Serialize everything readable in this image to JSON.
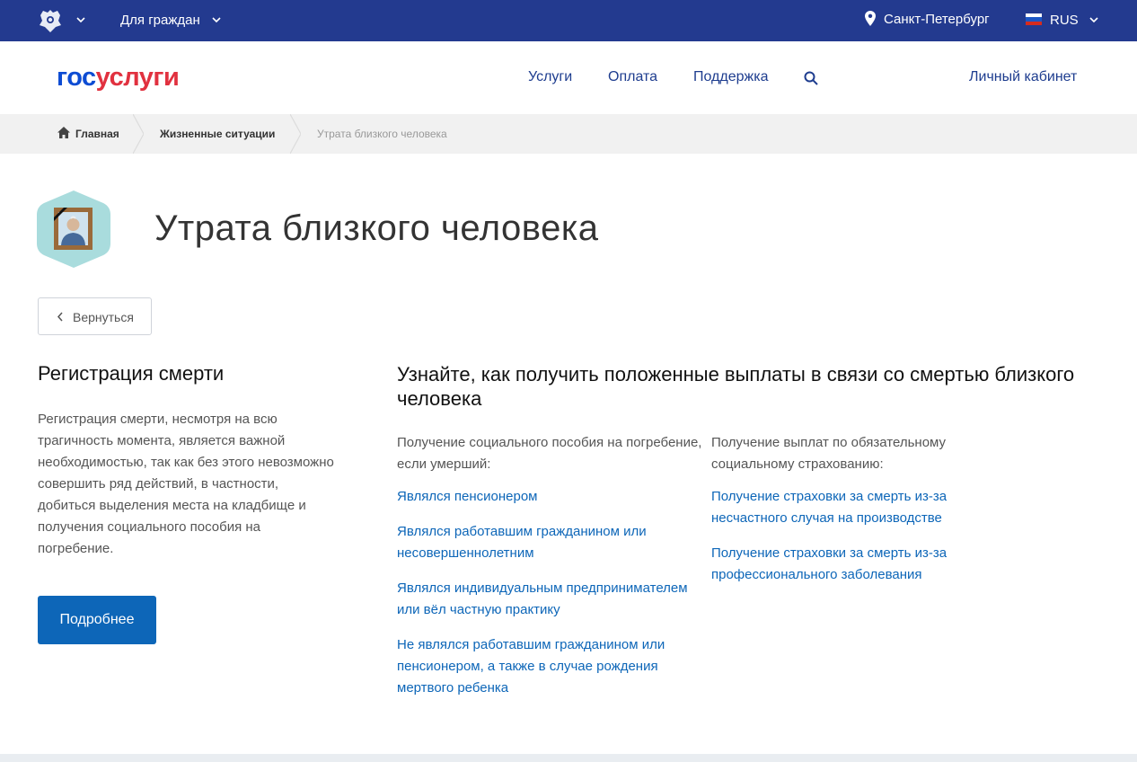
{
  "topbar": {
    "for_citizens": "Для граждан",
    "city": "Санкт-Петербург",
    "lang": "RUS"
  },
  "header": {
    "logo_gos": "гос",
    "logo_uslugi": "услуги",
    "nav": [
      "Услуги",
      "Оплата",
      "Поддержка"
    ],
    "cabinet": "Личный кабинет"
  },
  "breadcrumb": {
    "home": "Главная",
    "section": "Жизненные ситуации",
    "current": "Утрата близкого человека"
  },
  "page": {
    "title": "Утрата близкого человека",
    "back": "Вернуться"
  },
  "left": {
    "title": "Регистрация смерти",
    "description": "Регистрация смерти, несмотря на всю трагичность момента, является важной необходимостью, так как без этого невозможно совершить ряд действий, в частности, добиться выделения места на кладбище и получения социального пособия на погребение.",
    "more": "Подробнее"
  },
  "right": {
    "title": "Узнайте, как получить положенные выплаты в связи со смертью близкого человека",
    "col1": {
      "intro": "Получение социального пособия на погребение, если умерший:",
      "links": [
        "Являлся пенсионером",
        "Являлся работавшим гражданином или несовершеннолетним",
        "Являлся индивидуальным предпринимателем или вёл частную практику",
        "Не являлся работавшим гражданином или пенсионером, а также в случае рождения мертвого ребенка"
      ]
    },
    "col2": {
      "intro": "Получение выплат по обязательному социальному страхованию:",
      "links": [
        "Получение страховки за смерть из-за несчастного случая на производстве",
        "Получение страховки за смерть из-за профессионального заболевания"
      ]
    }
  },
  "colors": {
    "topbar": "#233a8f",
    "link": "#0d66b8",
    "nav": "#1e3d8f",
    "button": "#0d66b8",
    "logo_blue": "#0d4cd3",
    "logo_red": "#e1313f"
  },
  "icons": [
    "emblem-icon",
    "chevron-down-icon",
    "location-icon",
    "flag-icon",
    "search-icon",
    "home-icon",
    "portrait-icon",
    "chevron-left-icon"
  ]
}
